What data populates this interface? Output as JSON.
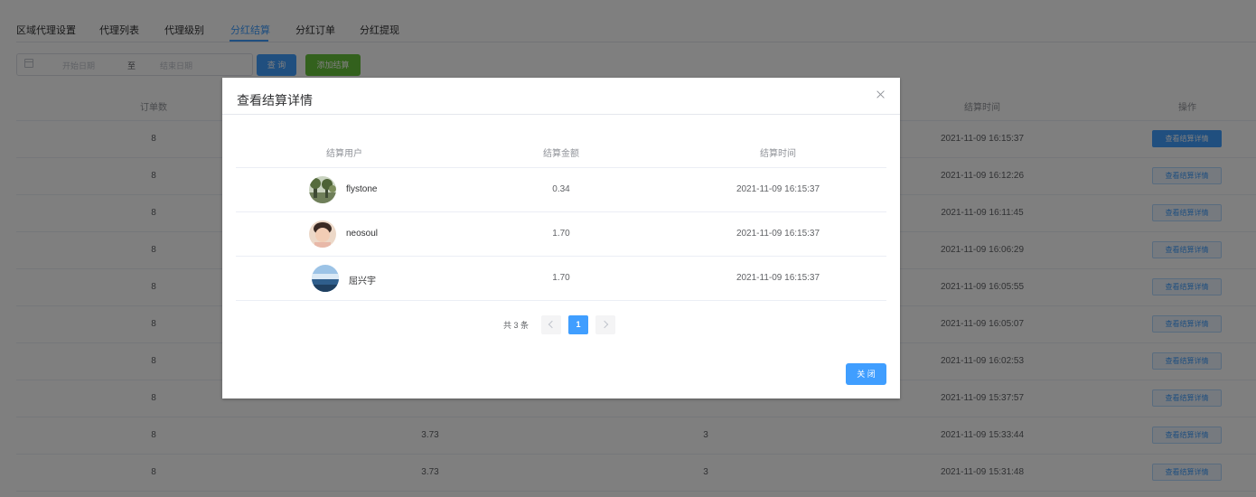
{
  "tabs": [
    {
      "label": "区域代理设置"
    },
    {
      "label": "代理列表"
    },
    {
      "label": "代理级别"
    },
    {
      "label": "分红结算",
      "active": true
    },
    {
      "label": "分红订单"
    },
    {
      "label": "分红提现"
    }
  ],
  "filter": {
    "start_placeholder": "开始日期",
    "separator": "至",
    "end_placeholder": "结束日期",
    "query_label": "查 询",
    "add_label": "添加结算"
  },
  "table": {
    "headers": {
      "orders": "订单数",
      "time": "结算时间",
      "action": "操作"
    },
    "action_label": "查看结算详情",
    "rows": [
      {
        "orders": "8",
        "amount": "",
        "count": "",
        "time": "2021-11-09 16:15:37"
      },
      {
        "orders": "8",
        "amount": "",
        "count": "",
        "time": "2021-11-09 16:12:26"
      },
      {
        "orders": "8",
        "amount": "",
        "count": "",
        "time": "2021-11-09 16:11:45"
      },
      {
        "orders": "8",
        "amount": "",
        "count": "",
        "time": "2021-11-09 16:06:29"
      },
      {
        "orders": "8",
        "amount": "",
        "count": "",
        "time": "2021-11-09 16:05:55"
      },
      {
        "orders": "8",
        "amount": "",
        "count": "",
        "time": "2021-11-09 16:05:07"
      },
      {
        "orders": "8",
        "amount": "",
        "count": "",
        "time": "2021-11-09 16:02:53"
      },
      {
        "orders": "8",
        "amount": "",
        "count": "",
        "time": "2021-11-09 15:37:57"
      },
      {
        "orders": "8",
        "amount": "3.73",
        "count": "3",
        "time": "2021-11-09 15:33:44"
      },
      {
        "orders": "8",
        "amount": "3.73",
        "count": "3",
        "time": "2021-11-09 15:31:48"
      }
    ]
  },
  "dialog": {
    "title": "查看结算详情",
    "headers": {
      "user": "结算用户",
      "amount": "结算金额",
      "time": "结算时间"
    },
    "rows": [
      {
        "user": "flystone",
        "amount": "0.34",
        "time": "2021-11-09 16:15:37",
        "avatar": "tree-landscape"
      },
      {
        "user": "neosoul",
        "amount": "1.70",
        "time": "2021-11-09 16:15:37",
        "avatar": "child-photo"
      },
      {
        "user": "屈兴宇",
        "amount": "1.70",
        "time": "2021-11-09 16:15:37",
        "avatar": "sky-sea"
      }
    ],
    "pagination": {
      "total_text": "共 3 条",
      "current_page": "1"
    },
    "close_label": "关 闭"
  }
}
